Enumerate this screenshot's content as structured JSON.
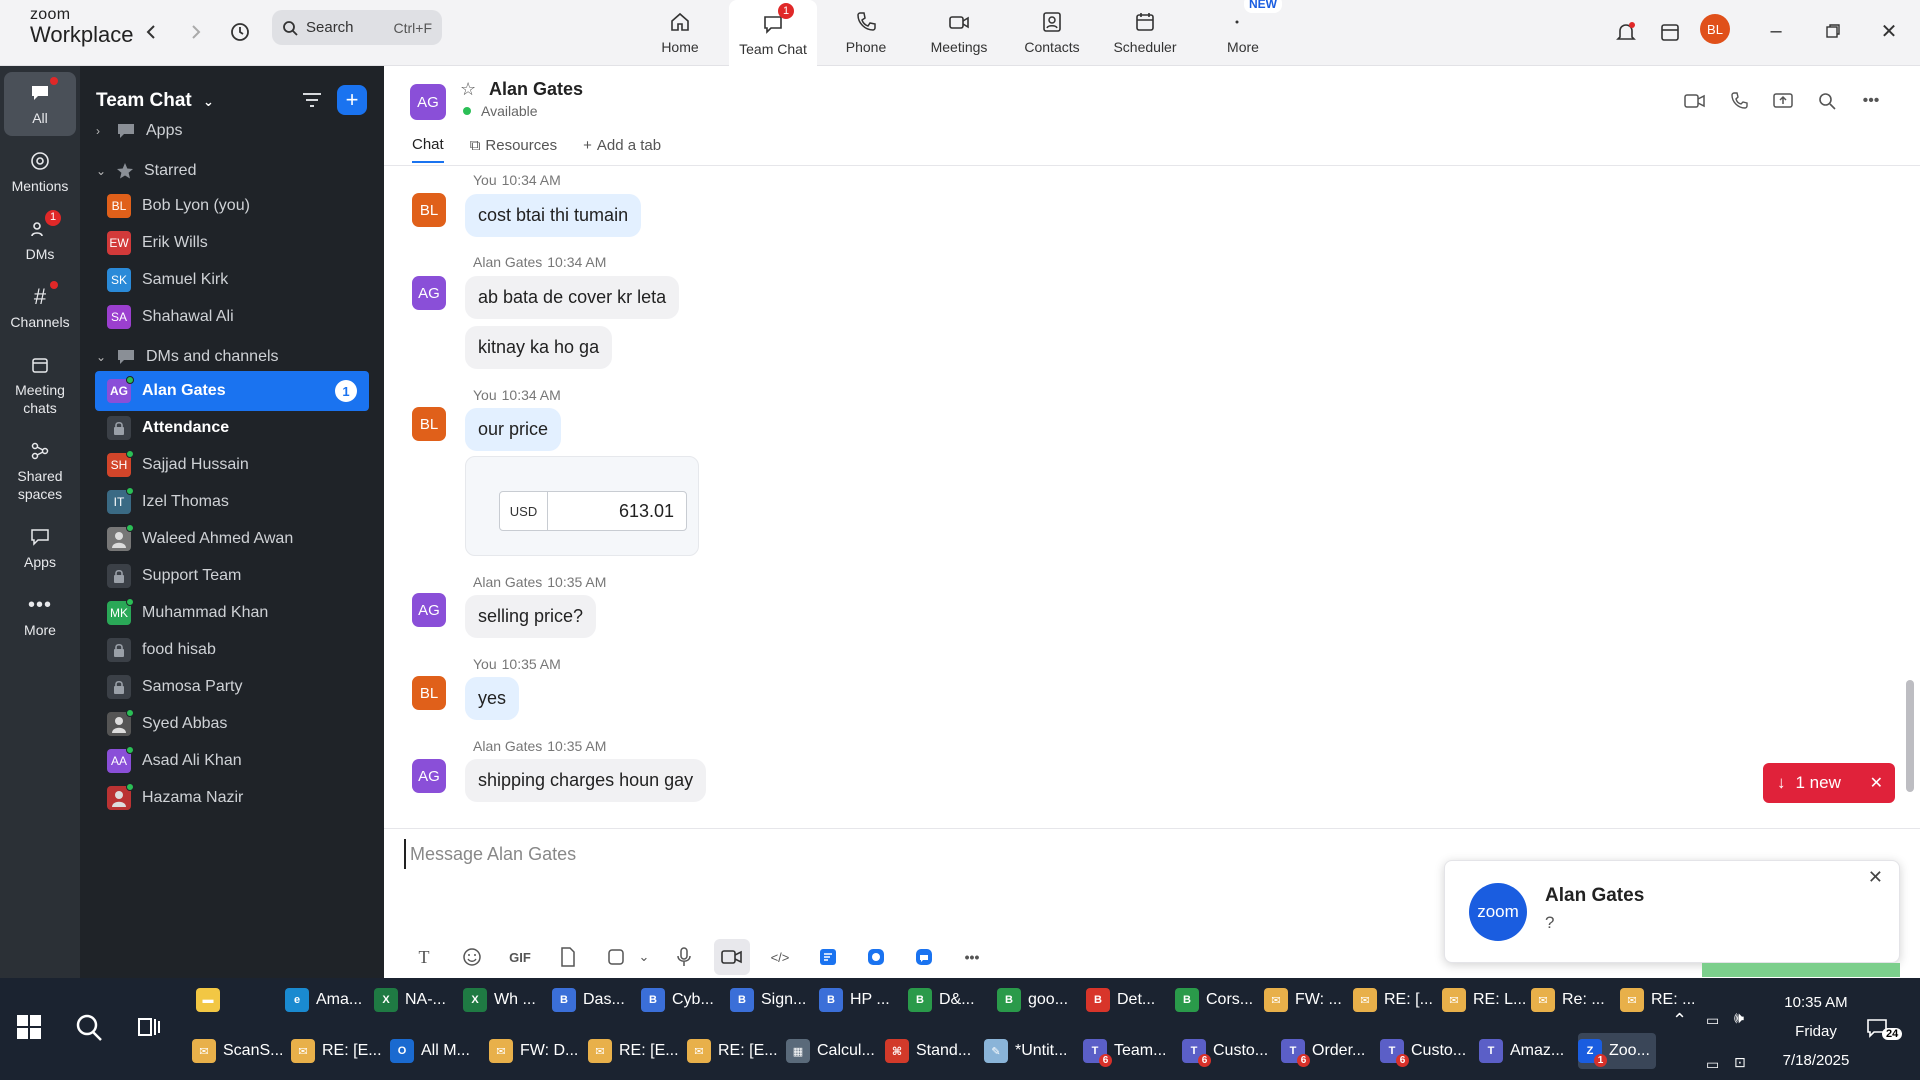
{
  "app": {
    "logo_line1": "zoom",
    "logo_line2": "Workplace"
  },
  "search": {
    "placeholder": "Search",
    "shortcut": "Ctrl+F"
  },
  "topnav": [
    {
      "label": "Home",
      "icon": "home-icon"
    },
    {
      "label": "Team Chat",
      "icon": "chat-icon",
      "badge": "1",
      "active": true
    },
    {
      "label": "Phone",
      "icon": "phone-icon"
    },
    {
      "label": "Meetings",
      "icon": "video-icon"
    },
    {
      "label": "Contacts",
      "icon": "contacts-icon"
    },
    {
      "label": "Scheduler",
      "icon": "calendar-icon"
    },
    {
      "label": "More",
      "icon": "more-icon",
      "new_pill": "NEW"
    }
  ],
  "user_avatar": "BL",
  "rail": [
    {
      "label": "All",
      "active": true
    },
    {
      "label": "Mentions"
    },
    {
      "label": "DMs",
      "badge": "1"
    },
    {
      "label": "Channels"
    },
    {
      "label": "Meeting chats"
    },
    {
      "label": "Shared spaces"
    },
    {
      "label": "Apps"
    },
    {
      "label": "More"
    }
  ],
  "sidebar": {
    "title": "Team Chat",
    "sections": {
      "apps": "Apps",
      "starred": "Starred",
      "dms": "DMs and channels"
    },
    "starred": [
      {
        "initials": "BL",
        "name": "Bob Lyon (you)",
        "color": "#e0601a"
      },
      {
        "initials": "EW",
        "name": "Erik Wills",
        "color": "#d23a3a"
      },
      {
        "initials": "SK",
        "name": "Samuel Kirk",
        "color": "#2a8ad8"
      },
      {
        "initials": "SA",
        "name": "Shahawal Ali",
        "color": "#9b3fcf"
      }
    ],
    "dms": [
      {
        "initials": "AG",
        "name": "Alan Gates",
        "color": "#8a4fd8",
        "count": "1",
        "active": true
      },
      {
        "name": "Attendance",
        "lock": true,
        "bold": true
      },
      {
        "initials": "SH",
        "name": "Sajjad Hussain",
        "color": "#d2452a"
      },
      {
        "initials": "IT",
        "name": "Izel Thomas",
        "color": "#3a6a84"
      },
      {
        "initials": "",
        "name": "Waleed Ahmed Awan",
        "color": "#777",
        "photo": true
      },
      {
        "name": "Support Team",
        "lock": true
      },
      {
        "initials": "MK",
        "name": "Muhammad Khan",
        "color": "#2aa857"
      },
      {
        "name": "food hisab",
        "lock": true
      },
      {
        "name": "Samosa Party",
        "lock": true
      },
      {
        "initials": "",
        "name": "Syed Abbas",
        "color": "#555",
        "photo": true
      },
      {
        "initials": "AA",
        "name": "Asad Ali Khan",
        "color": "#8a4fd8"
      },
      {
        "initials": "",
        "name": "Hazama Nazir",
        "color": "#b33",
        "photo": true
      }
    ]
  },
  "chat": {
    "name": "Alan Gates",
    "initials": "AG",
    "status": "Available",
    "tabs": [
      "Chat",
      "Resources",
      "Add a tab"
    ],
    "messages": [
      {
        "sender": "You",
        "time": "10:34 AM",
        "initials": "BL",
        "texts": [
          "cost btai thi tumain"
        ],
        "me": true
      },
      {
        "sender": "Alan Gates",
        "time": "10:34 AM",
        "initials": "AG",
        "texts": [
          "ab bata de cover kr leta",
          "kitnay ka ho ga"
        ]
      },
      {
        "sender": "You",
        "time": "10:34 AM",
        "initials": "BL",
        "texts": [
          "our price"
        ],
        "me": true
      },
      {
        "sender": "Alan Gates",
        "time": "10:35 AM",
        "initials": "AG",
        "texts": [
          "selling price?"
        ]
      },
      {
        "sender": "You",
        "time": "10:35 AM",
        "initials": "BL",
        "texts": [
          "yes"
        ],
        "me": true
      },
      {
        "sender": "Alan Gates",
        "time": "10:35 AM",
        "initials": "AG",
        "texts": [
          "shipping charges houn gay"
        ]
      }
    ],
    "price_card": {
      "currency": "USD",
      "value": "613.01"
    },
    "new_indicator": "1 new",
    "composer_placeholder": "Message Alan Gates"
  },
  "toast": {
    "logo": "zoom",
    "name": "Alan Gates",
    "message": "?"
  },
  "taskbar": {
    "row1": [
      {
        "label": "",
        "icon": "folder",
        "color": "#f2c744"
      },
      {
        "label": "Ama...",
        "icon": "edge",
        "color": "#1a8ad0"
      },
      {
        "label": "NA-...",
        "icon": "excel",
        "color": "#1f7a43"
      },
      {
        "label": "Wh ...",
        "icon": "excel",
        "color": "#1f7a43"
      },
      {
        "label": "Das...",
        "icon": "chrome",
        "color": "#3b6fd8"
      },
      {
        "label": "Cyb...",
        "icon": "chrome",
        "color": "#3b6fd8"
      },
      {
        "label": "Sign...",
        "icon": "chrome",
        "color": "#3b6fd8"
      },
      {
        "label": "HP ...",
        "icon": "chrome",
        "color": "#3b6fd8"
      },
      {
        "label": "D&...",
        "icon": "chrome",
        "color": "#2a9a4a"
      },
      {
        "label": "goo...",
        "icon": "chrome",
        "color": "#2a9a4a"
      },
      {
        "label": "Det...",
        "icon": "chrome",
        "color": "#d8352a"
      },
      {
        "label": "Cors...",
        "icon": "chrome",
        "color": "#2a9a4a"
      },
      {
        "label": "FW: ...",
        "icon": "mail",
        "color": "#e8b04a"
      },
      {
        "label": "RE: [...",
        "icon": "mail",
        "color": "#e8b04a"
      },
      {
        "label": "RE: L...",
        "icon": "mail",
        "color": "#e8b04a"
      },
      {
        "label": "Re: ...",
        "icon": "mail",
        "color": "#e8b04a"
      },
      {
        "label": "RE: ...",
        "icon": "mail",
        "color": "#e8b04a"
      }
    ],
    "row2": [
      {
        "label": "ScanS...",
        "icon": "mail",
        "color": "#e8b04a"
      },
      {
        "label": "RE: [E...",
        "icon": "mail",
        "color": "#e8b04a"
      },
      {
        "label": "All M...",
        "icon": "outlook",
        "color": "#1a6ad0"
      },
      {
        "label": "FW: D...",
        "icon": "mail",
        "color": "#e8b04a"
      },
      {
        "label": "RE: [E...",
        "icon": "mail",
        "color": "#e8b04a"
      },
      {
        "label": "RE: [E...",
        "icon": "mail",
        "color": "#e8b04a"
      },
      {
        "label": "Calcul...",
        "icon": "calculator",
        "color": "#5a6a7a"
      },
      {
        "label": "Stand...",
        "icon": "pdf",
        "color": "#d23a2a"
      },
      {
        "label": "*Untit...",
        "icon": "notepad",
        "color": "#8ab4d8"
      },
      {
        "label": "Team...",
        "icon": "teams",
        "color": "#5b5fc7",
        "badge": "6"
      },
      {
        "label": "Custo...",
        "icon": "teams",
        "color": "#5b5fc7",
        "badge": "6"
      },
      {
        "label": "Order...",
        "icon": "teams",
        "color": "#5b5fc7",
        "badge": "6"
      },
      {
        "label": "Custo...",
        "icon": "teams",
        "color": "#5b5fc7",
        "badge": "6"
      },
      {
        "label": "Amaz...",
        "icon": "teams",
        "color": "#5b5fc7"
      },
      {
        "label": "Zoo...",
        "icon": "zoom",
        "color": "#1a5de0",
        "badge": "1",
        "active": true
      }
    ],
    "time": "10:35 AM",
    "day": "Friday",
    "date": "7/18/2025",
    "notifications": "24"
  }
}
